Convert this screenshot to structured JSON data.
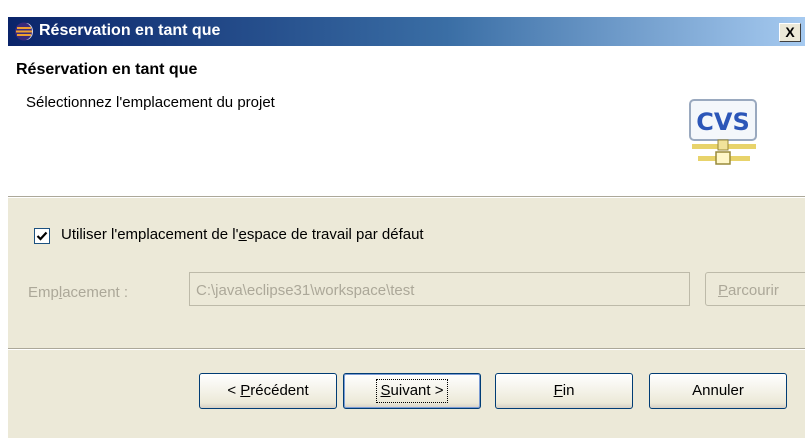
{
  "window": {
    "title": "Réservation en tant que",
    "close_label": "X"
  },
  "banner": {
    "title": "Réservation en tant que",
    "description": "Sélectionnez l'emplacement du projet",
    "icon": "cvs-icon",
    "icon_text": "CVS"
  },
  "options": {
    "use_default_checked": true,
    "use_default_label_pre": "Utiliser l'emplacement de l'",
    "use_default_label_mnemonic": "e",
    "use_default_label_post": "space de travail par défaut",
    "location_label_pre": "Emp",
    "location_label_mnemonic": "l",
    "location_label_post": "acement :",
    "location_value": "C:\\java\\eclipse31\\workspace\\test",
    "browse_mnemonic": "P",
    "browse_label_rest": "arcourir"
  },
  "buttons": {
    "back_pre": "< ",
    "back_mnemonic": "P",
    "back_post": "récédent",
    "next_mnemonic": "S",
    "next_post": "uivant >",
    "finish_mnemonic": "F",
    "finish_post": "in",
    "cancel_label": "Annuler"
  },
  "colors": {
    "title_bar": "#0a246a",
    "dialog_bg": "#ece9d8",
    "disabled_text": "#aca899"
  }
}
